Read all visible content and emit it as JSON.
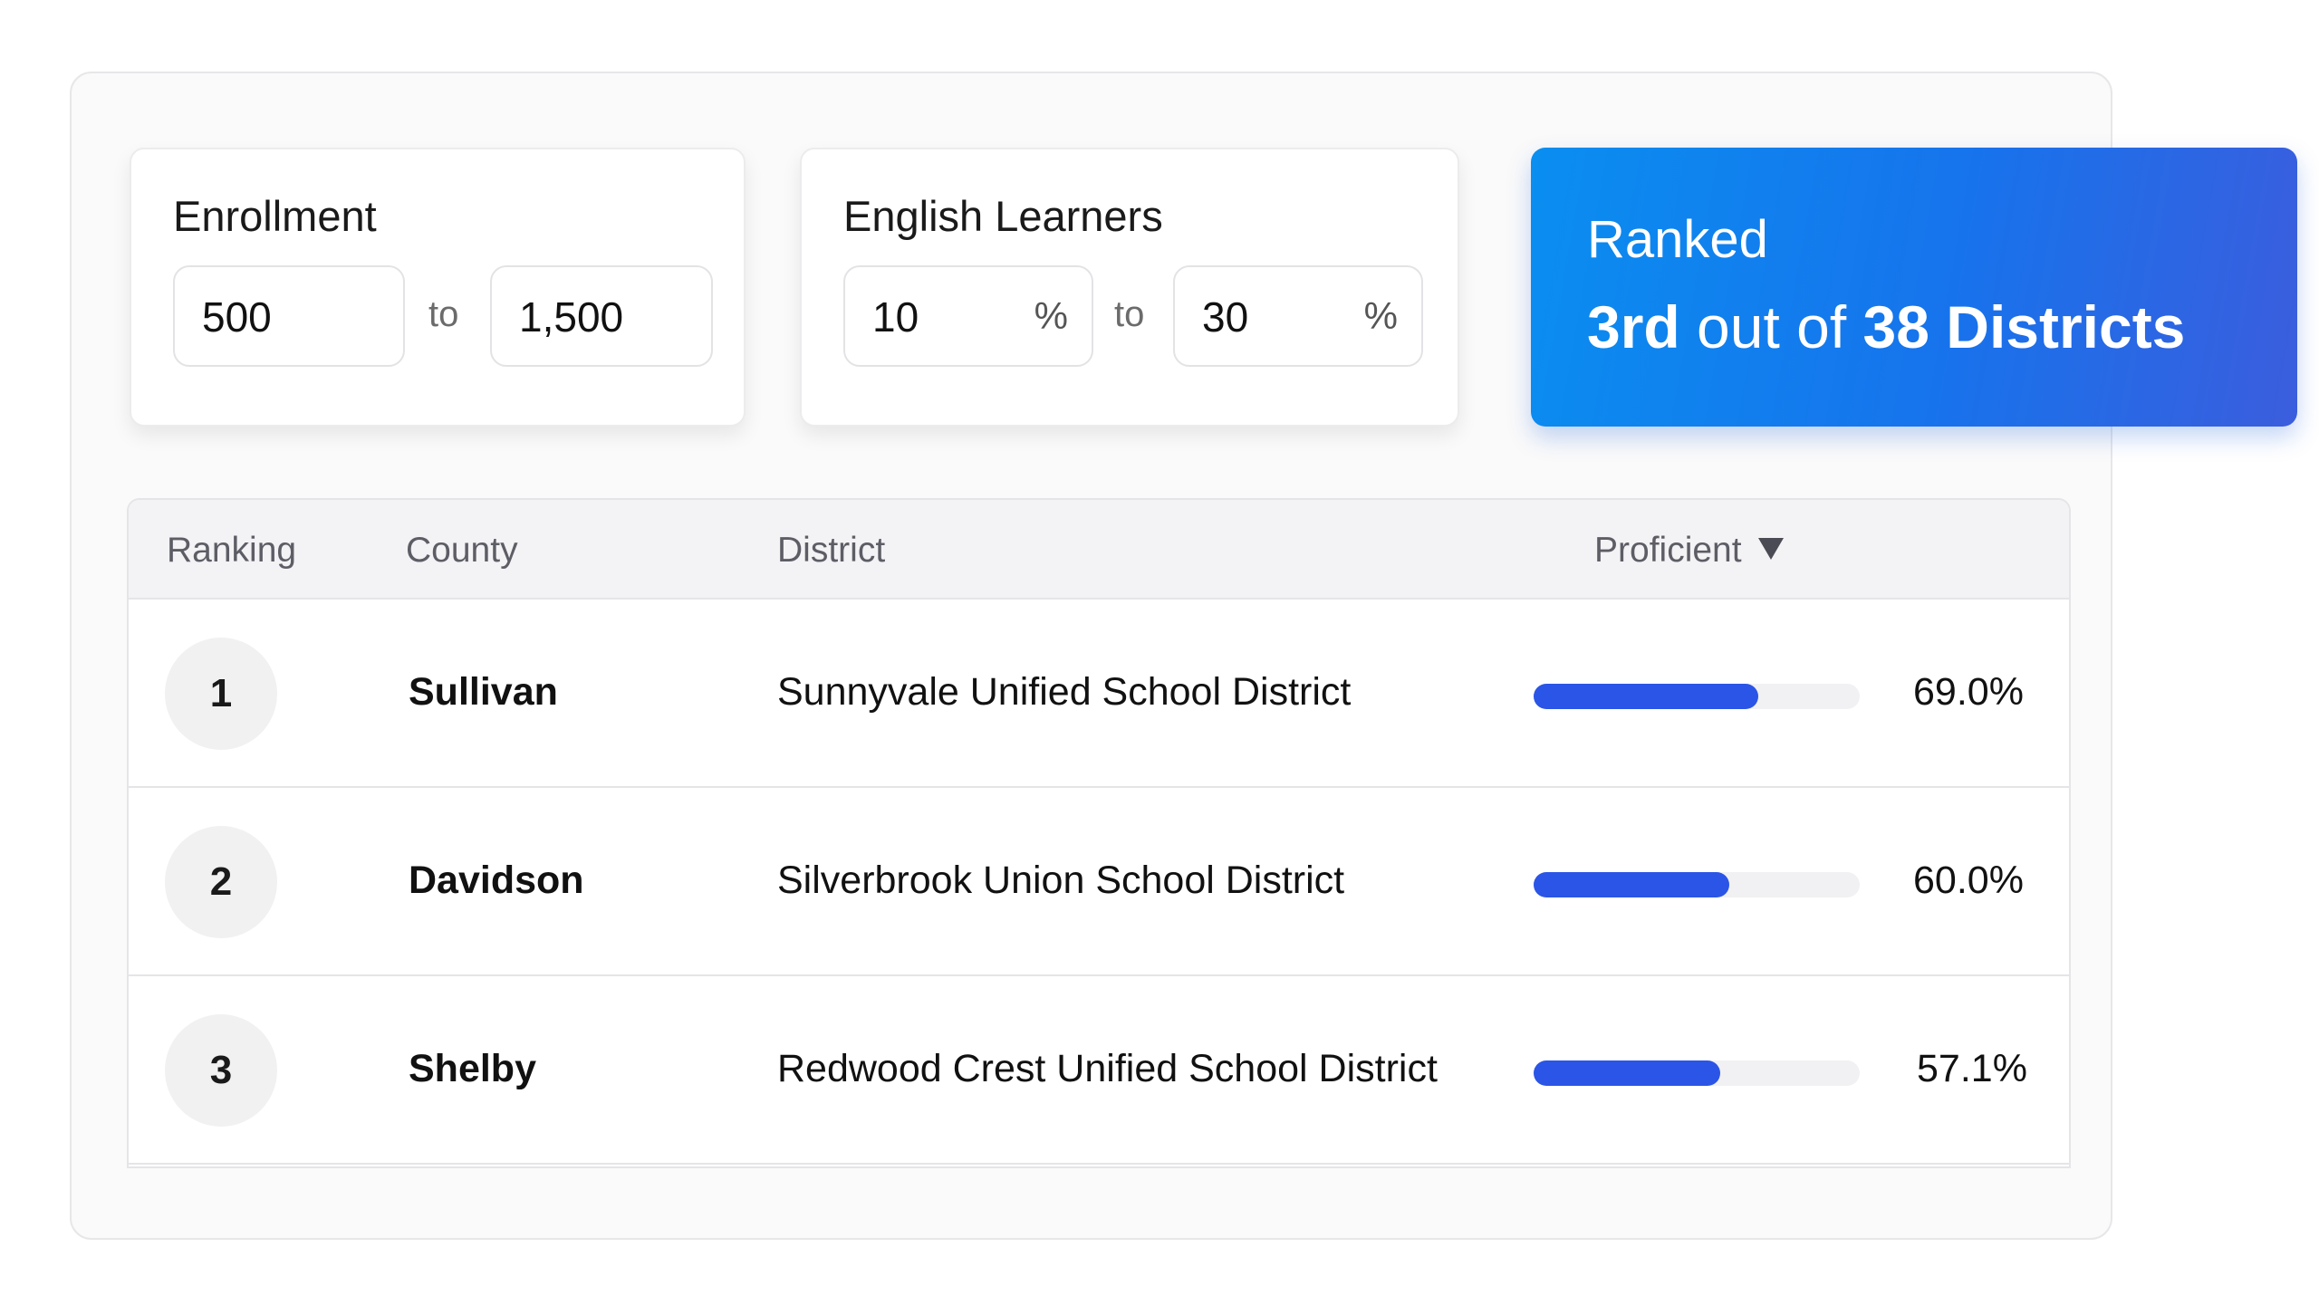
{
  "filters": {
    "enrollment": {
      "label": "Enrollment",
      "min": "500",
      "to_label": "to",
      "max": "1,500"
    },
    "english_learners": {
      "label": "English Learners",
      "min": "10",
      "max": "30",
      "unit": "%",
      "to_label": "to"
    }
  },
  "rank_card": {
    "title": "Ranked",
    "rank": "3rd",
    "out_of_label": " out of ",
    "total": "38 Districts"
  },
  "table": {
    "columns": {
      "ranking": "Ranking",
      "county": "County",
      "district": "District",
      "proficient": "Proficient"
    },
    "sort_icon": "triangle-down-icon",
    "rows": [
      {
        "rank": "1",
        "county": "Sullivan",
        "district": "Sunnyvale Unified School District",
        "proficient_value": 0.69,
        "proficient_label": "69.0%"
      },
      {
        "rank": "2",
        "county": "Davidson",
        "district": "Silverbrook Union School District",
        "proficient_value": 0.6,
        "proficient_label": "60.0%"
      },
      {
        "rank": "3",
        "county": "Shelby",
        "district": "Redwood Crest Unified School District",
        "proficient_value": 0.571,
        "proficient_label": "57.1%"
      }
    ]
  },
  "colors": {
    "accent_bar": "#2b55e6",
    "rank_card_gradient_start": "#0a8ef0",
    "rank_card_gradient_end": "#3b5ddd"
  }
}
